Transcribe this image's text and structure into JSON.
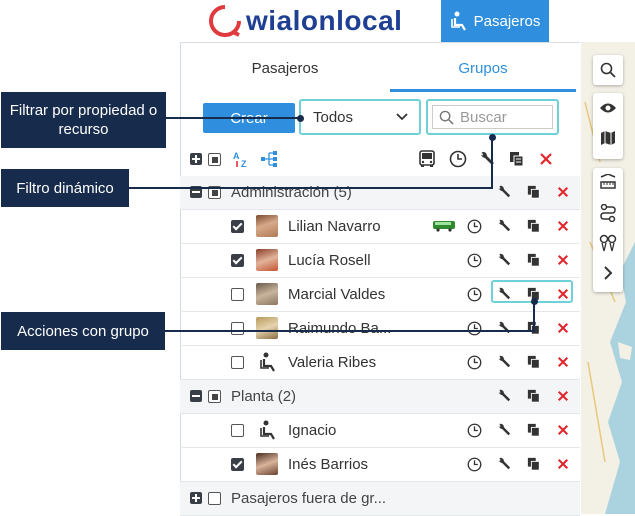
{
  "header": {
    "logo_main": "wialon",
    "logo_accent": "local",
    "module_button": "Pasajeros"
  },
  "tabs": [
    {
      "label": "Pasajeros"
    },
    {
      "label": "Grupos"
    }
  ],
  "controls": {
    "create_button": "Crear",
    "filter_select_value": "Todos",
    "search_placeholder": "Buscar"
  },
  "groups": [
    {
      "label": "Administración (5)",
      "members": [
        {
          "name": "Lilian Navarro",
          "checked": true
        },
        {
          "name": "Lucía Rosell",
          "checked": true
        },
        {
          "name": "Marcial Valdes",
          "checked": false
        },
        {
          "name": "Raimundo Ba...",
          "checked": false
        },
        {
          "name": "Valeria Ribes",
          "checked": false
        }
      ]
    },
    {
      "label": "Planta (2)",
      "members": [
        {
          "name": "Ignacio",
          "checked": false
        },
        {
          "name": "Inés Barrios",
          "checked": true
        }
      ]
    },
    {
      "label": "Pasajeros fuera de gr...",
      "members": []
    }
  ],
  "callouts": {
    "filter_by_property": "Filtrar por propiedad o recurso",
    "dynamic_filter": "Filtro dinámico",
    "group_actions": "Acciones con grupo"
  },
  "colors": {
    "primary": "#2f8fde",
    "highlight": "#6fd0d8",
    "callout_bg": "#172b4d",
    "delete": "#e0262c",
    "logo_blue": "#1f3f93",
    "logo_red": "#e03a3e"
  },
  "icons": [
    "passenger-icon",
    "search-icon",
    "chevron-down-icon",
    "sort-az-icon",
    "hierarchy-icon",
    "bus-icon",
    "clock-icon",
    "wrench-icon",
    "copy-icon",
    "close-icon",
    "eye-icon",
    "map-icon",
    "ruler-icon",
    "route-icon",
    "pin-icon",
    "chevron-right-icon"
  ]
}
